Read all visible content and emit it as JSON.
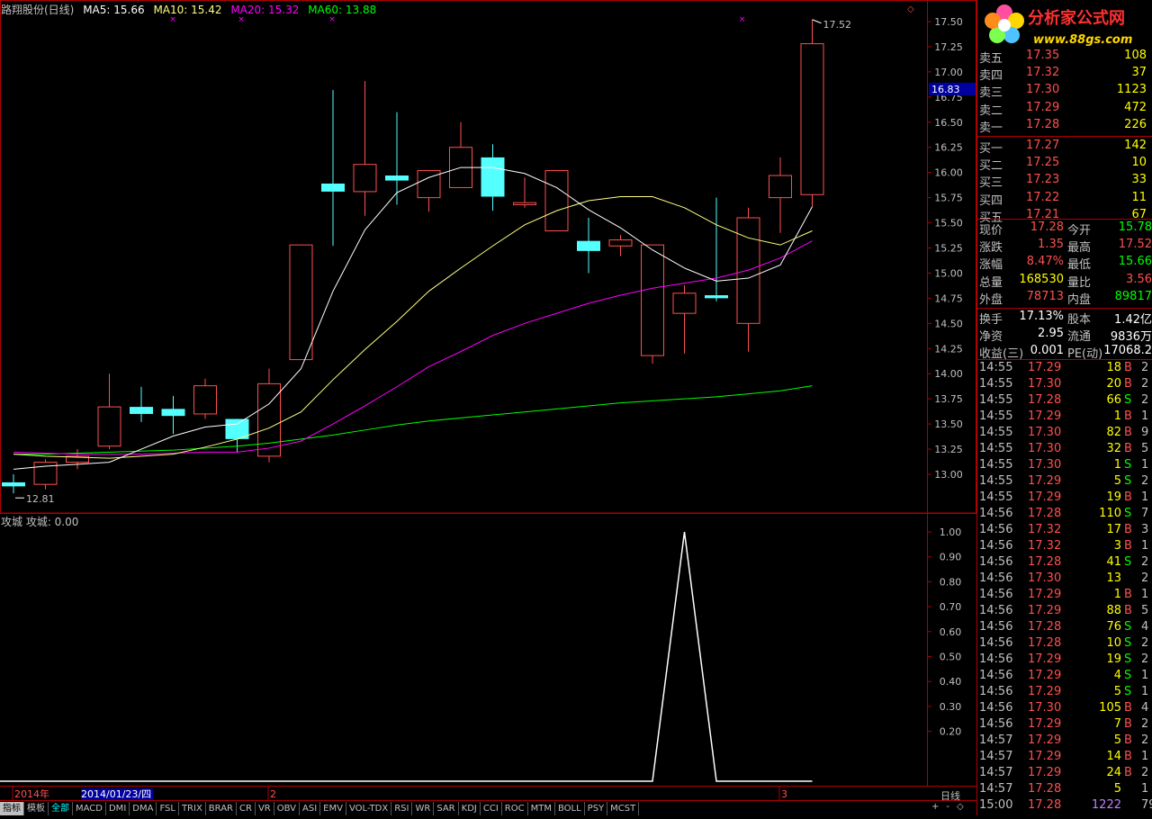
{
  "header": {
    "stock_title": "路翔股份(日线)",
    "ma5": "MA5: 15.66",
    "ma10": "MA10: 15.42",
    "ma20": "MA20: 15.32",
    "ma60": "MA60: 13.88"
  },
  "sub_header": "攻城  攻城: 0.00",
  "current_price_box": "16.83",
  "high_marker": "17.52",
  "low_marker": "12.81",
  "date_box": "2014/01/23/四",
  "period_label": "日线",
  "tabs": [
    "指标",
    "模板",
    "全部",
    "MACD",
    "DMI",
    "DMA",
    "FSL",
    "TRIX",
    "BRAR",
    "CR",
    "VR",
    "OBV",
    "ASI",
    "EMV",
    "VOL-TDX",
    "RSI",
    "WR",
    "SAR",
    "KDJ",
    "CCI",
    "ROC",
    "MTM",
    "BOLL",
    "PSY",
    "MCST"
  ],
  "nav_controls": [
    "+",
    "-",
    "◇"
  ],
  "logo_text": "分析家公式网",
  "logo_url": "www.88gs.com",
  "order_book": [
    {
      "label": "卖五",
      "price": "17.35",
      "vol": "108"
    },
    {
      "label": "卖四",
      "price": "17.32",
      "vol": "37"
    },
    {
      "label": "卖三",
      "price": "17.30",
      "vol": "1123"
    },
    {
      "label": "卖二",
      "price": "17.29",
      "vol": "472"
    },
    {
      "label": "卖一",
      "price": "17.28",
      "vol": "226"
    },
    {
      "label": "买一",
      "price": "17.27",
      "vol": "142"
    },
    {
      "label": "买二",
      "price": "17.25",
      "vol": "10"
    },
    {
      "label": "买三",
      "price": "17.23",
      "vol": "33"
    },
    {
      "label": "买四",
      "price": "17.22",
      "vol": "11"
    },
    {
      "label": "买五",
      "price": "17.21",
      "vol": "67"
    }
  ],
  "stats": [
    {
      "l1": "现价",
      "v1": "17.28",
      "c1": "#ff5050",
      "l2": "今开",
      "v2": "15.78",
      "c2": "#00ff00"
    },
    {
      "l1": "涨跌",
      "v1": "1.35",
      "c1": "#ff5050",
      "l2": "最高",
      "v2": "17.52",
      "c2": "#ff5050"
    },
    {
      "l1": "涨幅",
      "v1": "8.47%",
      "c1": "#ff5050",
      "l2": "最低",
      "v2": "15.66",
      "c2": "#00ff00"
    },
    {
      "l1": "总量",
      "v1": "168530",
      "c1": "#ffff00",
      "l2": "量比",
      "v2": "3.56",
      "c2": "#ff5050"
    },
    {
      "l1": "外盘",
      "v1": "78713",
      "c1": "#ff5050",
      "l2": "内盘",
      "v2": "89817",
      "c2": "#00ff00"
    },
    {
      "l1": "换手",
      "v1": "17.13%",
      "c1": "#ffffff",
      "l2": "股本",
      "v2": "1.42亿",
      "c2": "#ffffff"
    },
    {
      "l1": "净资",
      "v1": "2.95",
      "c1": "#ffffff",
      "l2": "流通",
      "v2": "9836万",
      "c2": "#ffffff"
    },
    {
      "l1": "收益(三)",
      "v1": "0.001",
      "c1": "#ffffff",
      "l2": "PE(动)",
      "v2": "17068.2",
      "c2": "#ffffff"
    }
  ],
  "ticks": [
    {
      "t": "14:55",
      "p": "17.29",
      "v": "18",
      "bs": "B",
      "n": "2"
    },
    {
      "t": "14:55",
      "p": "17.30",
      "v": "20",
      "bs": "B",
      "n": "2"
    },
    {
      "t": "14:55",
      "p": "17.28",
      "v": "66",
      "bs": "S",
      "n": "2"
    },
    {
      "t": "14:55",
      "p": "17.29",
      "v": "1",
      "bs": "B",
      "n": "1"
    },
    {
      "t": "14:55",
      "p": "17.30",
      "v": "82",
      "bs": "B",
      "n": "9"
    },
    {
      "t": "14:55",
      "p": "17.30",
      "v": "32",
      "bs": "B",
      "n": "5"
    },
    {
      "t": "14:55",
      "p": "17.30",
      "v": "1",
      "bs": "S",
      "n": "1"
    },
    {
      "t": "14:55",
      "p": "17.29",
      "v": "5",
      "bs": "S",
      "n": "2"
    },
    {
      "t": "14:55",
      "p": "17.29",
      "v": "19",
      "bs": "B",
      "n": "1"
    },
    {
      "t": "14:56",
      "p": "17.28",
      "v": "110",
      "bs": "S",
      "n": "7"
    },
    {
      "t": "14:56",
      "p": "17.32",
      "v": "17",
      "bs": "B",
      "n": "3"
    },
    {
      "t": "14:56",
      "p": "17.32",
      "v": "3",
      "bs": "B",
      "n": "1"
    },
    {
      "t": "14:56",
      "p": "17.28",
      "v": "41",
      "bs": "S",
      "n": "2"
    },
    {
      "t": "14:56",
      "p": "17.30",
      "v": "13",
      "bs": "",
      "n": "2"
    },
    {
      "t": "14:56",
      "p": "17.29",
      "v": "1",
      "bs": "B",
      "n": "1"
    },
    {
      "t": "14:56",
      "p": "17.29",
      "v": "88",
      "bs": "B",
      "n": "5"
    },
    {
      "t": "14:56",
      "p": "17.28",
      "v": "76",
      "bs": "S",
      "n": "4"
    },
    {
      "t": "14:56",
      "p": "17.28",
      "v": "10",
      "bs": "S",
      "n": "2"
    },
    {
      "t": "14:56",
      "p": "17.29",
      "v": "19",
      "bs": "S",
      "n": "2"
    },
    {
      "t": "14:56",
      "p": "17.29",
      "v": "4",
      "bs": "S",
      "n": "1"
    },
    {
      "t": "14:56",
      "p": "17.29",
      "v": "5",
      "bs": "S",
      "n": "1"
    },
    {
      "t": "14:56",
      "p": "17.30",
      "v": "105",
      "bs": "B",
      "n": "4"
    },
    {
      "t": "14:56",
      "p": "17.29",
      "v": "7",
      "bs": "B",
      "n": "2"
    },
    {
      "t": "14:57",
      "p": "17.29",
      "v": "5",
      "bs": "B",
      "n": "2"
    },
    {
      "t": "14:57",
      "p": "17.29",
      "v": "14",
      "bs": "B",
      "n": "1"
    },
    {
      "t": "14:57",
      "p": "17.29",
      "v": "24",
      "bs": "B",
      "n": "2"
    },
    {
      "t": "14:57",
      "p": "17.28",
      "v": "5",
      "bs": "",
      "n": "1"
    },
    {
      "t": "15:00",
      "p": "17.28",
      "v": "1222",
      "bs": "",
      "n": "79"
    }
  ],
  "colors": {
    "up": "#ff5050",
    "down": "#54ffff",
    "ma5": "#ffffff",
    "ma10": "#ffff80",
    "ma20": "#ff00ff",
    "ma60": "#00ff00",
    "grid": "#b00000",
    "axis_text": "#c0c0c0",
    "buy": "#ff5050",
    "sell": "#00ff00"
  },
  "chart_data": [
    {
      "type": "candlestick",
      "title": "路翔股份(日线)",
      "ylim": [
        12.8,
        17.55
      ],
      "y_ticks": [
        "17.50",
        "17.25",
        "17.00",
        "16.75",
        "16.50",
        "16.25",
        "16.00",
        "15.75",
        "15.50",
        "15.25",
        "15.00",
        "14.75",
        "14.50",
        "14.25",
        "14.00",
        "13.75",
        "13.50",
        "13.25",
        "13.00"
      ],
      "x_labels": [
        {
          "label": "2014年",
          "index": 0
        },
        {
          "label": "2",
          "index": 11
        },
        {
          "label": "3",
          "index": 34
        }
      ],
      "candles": [
        {
          "o": 12.92,
          "h": 13.0,
          "l": 12.81,
          "c": 12.88
        },
        {
          "o": 12.9,
          "h": 13.15,
          "l": 12.85,
          "c": 13.12
        },
        {
          "o": 13.12,
          "h": 13.25,
          "l": 13.05,
          "c": 13.18
        },
        {
          "o": 13.28,
          "h": 14.0,
          "l": 13.25,
          "c": 13.67
        },
        {
          "o": 13.67,
          "h": 13.87,
          "l": 13.52,
          "c": 13.6
        },
        {
          "o": 13.65,
          "h": 13.78,
          "l": 13.4,
          "c": 13.58
        },
        {
          "o": 13.6,
          "h": 13.95,
          "l": 13.55,
          "c": 13.88
        },
        {
          "o": 13.55,
          "h": 13.55,
          "l": 13.22,
          "c": 13.35
        },
        {
          "o": 13.18,
          "h": 14.05,
          "l": 13.12,
          "c": 13.9
        },
        {
          "o": 14.14,
          "h": 15.28,
          "l": 14.14,
          "c": 15.28
        },
        {
          "o": 15.89,
          "h": 16.82,
          "l": 15.27,
          "c": 15.81
        },
        {
          "o": 15.81,
          "h": 16.91,
          "l": 15.57,
          "c": 16.08
        },
        {
          "o": 15.97,
          "h": 16.6,
          "l": 15.68,
          "c": 15.92
        },
        {
          "o": 15.75,
          "h": 16.02,
          "l": 15.61,
          "c": 16.02
        },
        {
          "o": 15.85,
          "h": 16.5,
          "l": 15.88,
          "c": 16.25
        },
        {
          "o": 16.15,
          "h": 16.28,
          "l": 15.62,
          "c": 15.76
        },
        {
          "o": 15.68,
          "h": 15.95,
          "l": 15.65,
          "c": 15.7
        },
        {
          "o": 15.42,
          "h": 15.7,
          "l": 15.45,
          "c": 16.02
        },
        {
          "o": 15.32,
          "h": 15.55,
          "l": 15.0,
          "c": 15.22
        },
        {
          "o": 15.27,
          "h": 15.38,
          "l": 15.17,
          "c": 15.33
        },
        {
          "o": 14.18,
          "h": 15.28,
          "l": 14.1,
          "c": 15.28
        },
        {
          "o": 14.6,
          "h": 14.88,
          "l": 14.2,
          "c": 14.8
        },
        {
          "o": 14.78,
          "h": 15.75,
          "l": 14.72,
          "c": 14.75
        },
        {
          "o": 14.5,
          "h": 15.65,
          "l": 14.22,
          "c": 15.55
        },
        {
          "o": 15.75,
          "h": 16.15,
          "l": 15.4,
          "c": 15.97
        },
        {
          "o": 15.78,
          "h": 17.52,
          "l": 15.66,
          "c": 17.28
        }
      ],
      "ma5": [
        13.05,
        13.08,
        13.1,
        13.12,
        13.25,
        13.38,
        13.47,
        13.5,
        13.7,
        14.05,
        14.82,
        15.43,
        15.8,
        15.95,
        16.05,
        16.05,
        15.99,
        15.85,
        15.63,
        15.45,
        15.23,
        15.05,
        14.92,
        14.95,
        15.08,
        15.66
      ],
      "ma10": [
        13.2,
        13.18,
        13.17,
        13.16,
        13.18,
        13.2,
        13.27,
        13.35,
        13.46,
        13.62,
        13.94,
        14.24,
        14.52,
        14.82,
        15.05,
        15.27,
        15.48,
        15.62,
        15.72,
        15.76,
        15.76,
        15.65,
        15.48,
        15.35,
        15.28,
        15.42
      ],
      "ma20": [
        13.22,
        13.21,
        13.2,
        13.2,
        13.2,
        13.21,
        13.22,
        13.22,
        13.26,
        13.33,
        13.5,
        13.68,
        13.87,
        14.07,
        14.22,
        14.38,
        14.5,
        14.6,
        14.7,
        14.78,
        14.85,
        14.9,
        14.95,
        15.03,
        15.15,
        15.32
      ],
      "ma60": [
        13.2,
        13.2,
        13.21,
        13.22,
        13.23,
        13.24,
        13.26,
        13.28,
        13.31,
        13.35,
        13.39,
        13.44,
        13.49,
        13.53,
        13.56,
        13.59,
        13.62,
        13.65,
        13.68,
        13.71,
        13.73,
        13.75,
        13.77,
        13.8,
        13.83,
        13.88
      ],
      "marks": [
        7,
        10,
        14,
        32
      ]
    },
    {
      "type": "line",
      "title": "攻城",
      "ylim": [
        0,
        1.0
      ],
      "y_ticks": [
        "1.00",
        "0.90",
        "0.80",
        "0.70",
        "0.60",
        "0.50",
        "0.40",
        "0.30",
        "0.20"
      ],
      "series": [
        {
          "name": "攻城",
          "values": [
            0,
            0,
            0,
            0,
            0,
            0,
            0,
            0,
            0,
            0,
            0,
            0,
            0,
            0,
            0,
            0,
            0,
            0,
            0,
            0,
            0,
            1,
            0,
            0,
            0,
            0
          ]
        }
      ]
    }
  ]
}
